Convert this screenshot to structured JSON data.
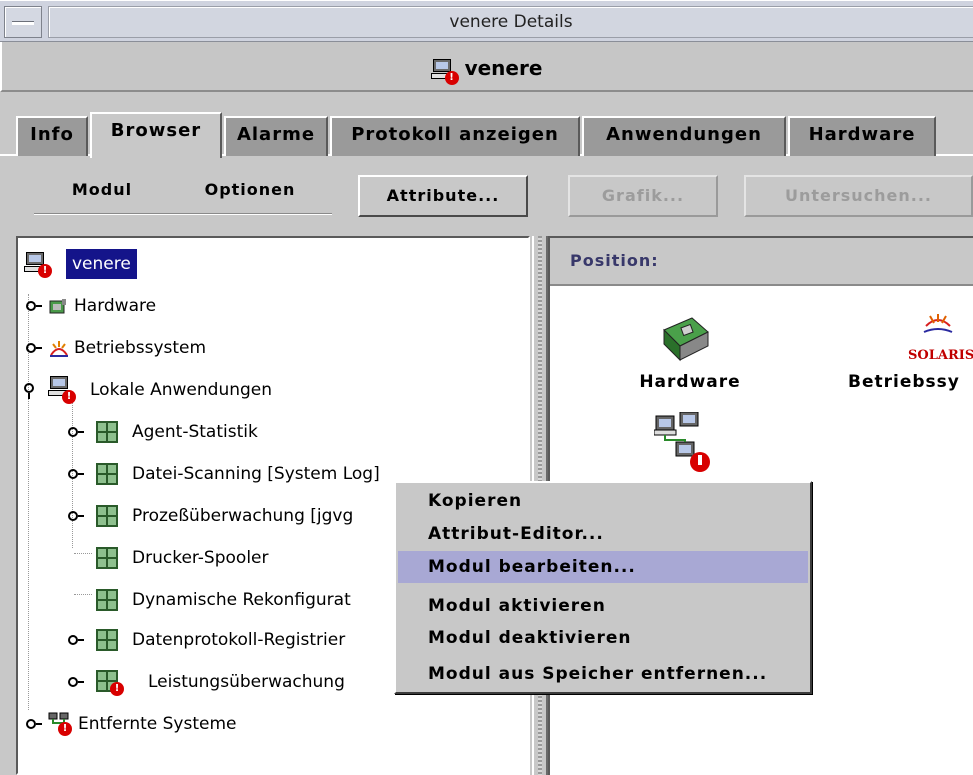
{
  "window": {
    "title": "venere Details"
  },
  "header": {
    "host_name": "venere"
  },
  "tabs": [
    {
      "label": "Info"
    },
    {
      "label": "Browser"
    },
    {
      "label": "Alarme"
    },
    {
      "label": "Protokoll anzeigen"
    },
    {
      "label": "Anwendungen"
    },
    {
      "label": "Hardware"
    }
  ],
  "active_tab": "Browser",
  "toolbar": {
    "menu_module": "Modul",
    "menu_options": "Optionen",
    "attributes_button": "Attribute...",
    "graph_button": "Grafik...",
    "probe_button": "Untersuchen..."
  },
  "tree": {
    "root": "venere",
    "items": [
      {
        "label": "Hardware"
      },
      {
        "label": "Betriebssystem"
      },
      {
        "label": "Lokale Anwendungen"
      },
      {
        "label": "Agent-Statistik"
      },
      {
        "label": "Datei-Scanning [System Log]"
      },
      {
        "label": "Prozeßüberwachung [jgvg"
      },
      {
        "label": "Drucker-Spooler"
      },
      {
        "label": "Dynamische Rekonfigurat"
      },
      {
        "label": "Datenprotokoll-Registrier"
      },
      {
        "label": "Leistungsüberwachung"
      },
      {
        "label": "Entfernte Systeme"
      }
    ]
  },
  "detail": {
    "position_label": "Position:",
    "items": [
      {
        "label": "Hardware"
      },
      {
        "label": "Betriebssy"
      },
      {
        "label": "SOLARIS"
      }
    ]
  },
  "context_menu": {
    "items": [
      {
        "label": "Kopieren"
      },
      {
        "label": "Attribut-Editor..."
      },
      {
        "label": "Modul bearbeiten..."
      },
      {
        "label": "Modul aktivieren"
      },
      {
        "label": "Modul deaktivieren"
      },
      {
        "label": "Modul aus Speicher entfernen..."
      }
    ],
    "highlighted": "Modul bearbeiten..."
  },
  "colors": {
    "selection": "#14148a",
    "menu_highlight": "#a8a8d4",
    "alarm": "#d80000",
    "position_text": "#38386a"
  },
  "icons": {
    "alarm_badge": "!"
  }
}
